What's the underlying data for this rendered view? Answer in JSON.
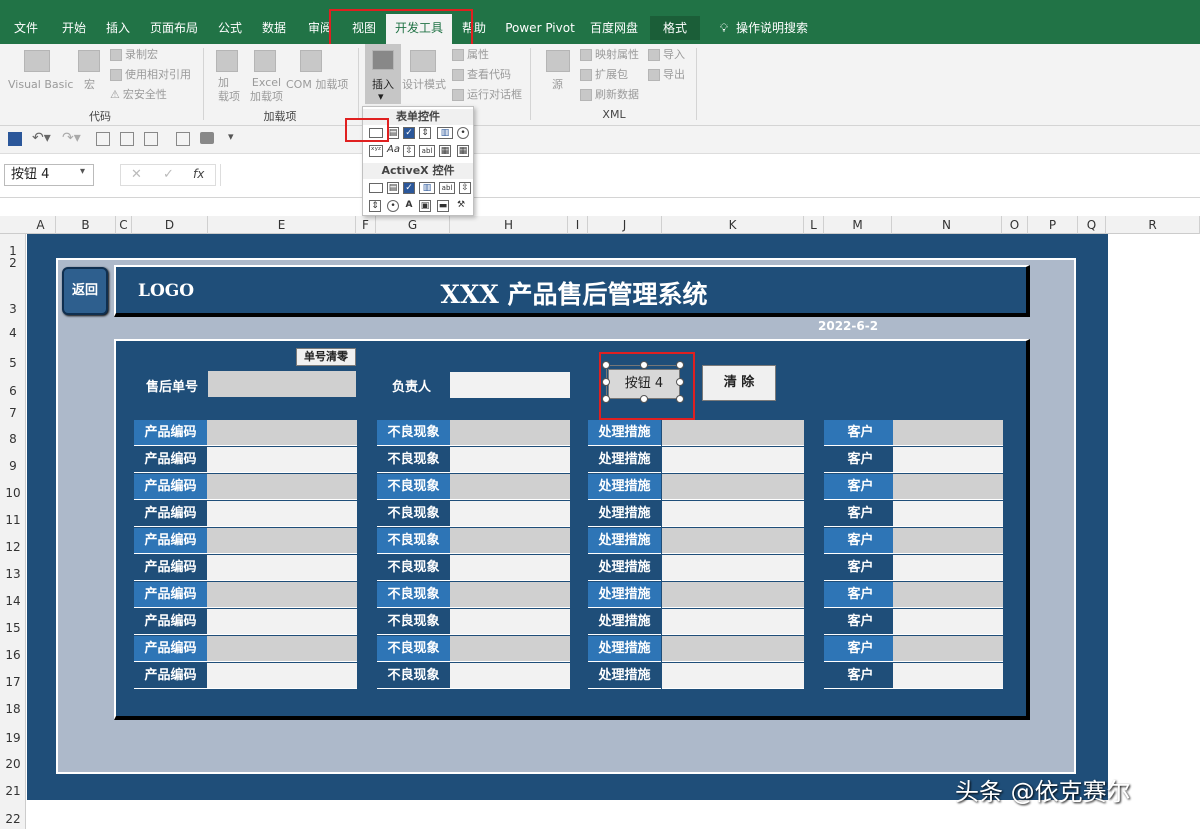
{
  "tabs": [
    "文件",
    "开始",
    "插入",
    "页面布局",
    "公式",
    "数据",
    "审阅",
    "视图",
    "开发工具",
    "帮助",
    "Power Pivot",
    "百度网盘",
    "格式"
  ],
  "tell_me": "操作说明搜索",
  "ribbon": {
    "code": {
      "label": "代码",
      "vb": "Visual Basic",
      "macro": "宏",
      "record": "录制宏",
      "relative": "使用相对引用",
      "security": "宏安全性"
    },
    "addins": {
      "label": "加载项",
      "addin": "加\n载项",
      "excel": "Excel\n加载项",
      "com": "COM 加载项"
    },
    "controls": {
      "insert": "插入",
      "design": "设计模式",
      "props": "属性",
      "viewcode": "查看代码",
      "dialog": "运行对话框"
    },
    "xml": {
      "label": "XML",
      "source": "源",
      "mapprops": "映射属性",
      "expand": "扩展包",
      "refresh": "刷新数据",
      "import": "导入",
      "export": "导出"
    }
  },
  "dropdown": {
    "form_controls": "表单控件",
    "activex": "ActiveX 控件"
  },
  "namebox": "按钮 4",
  "fx": "fx",
  "columns": [
    "A",
    "B",
    "C",
    "D",
    "E",
    "F",
    "G",
    "H",
    "I",
    "J",
    "K",
    "L",
    "M",
    "N",
    "O",
    "P",
    "Q",
    "R"
  ],
  "rows": [
    "1",
    "2",
    "3",
    "4",
    "5",
    "6",
    "7",
    "8",
    "9",
    "10",
    "11",
    "12",
    "13",
    "14",
    "15",
    "16",
    "17",
    "18",
    "19",
    "20",
    "21",
    "22"
  ],
  "sheet": {
    "back": "返回",
    "logo": "LOGO",
    "title": "XXX 产品售后管理系统",
    "date": "2022-6-2",
    "order_label": "售后单号",
    "clear_order": "单号清零",
    "owner_label": "负责人",
    "button4": "按钮 4",
    "clear": "清 除",
    "col_labels": [
      "产品编码",
      "不良现象",
      "处理措施",
      "客户"
    ]
  },
  "watermark": "头条 @依克赛尔"
}
